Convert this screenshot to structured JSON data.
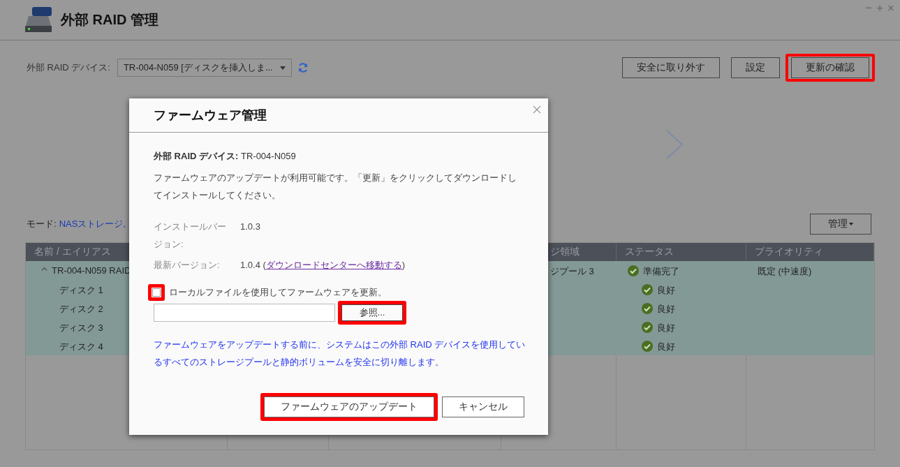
{
  "app": {
    "title": "外部 RAID 管理",
    "window_controls": [
      "−",
      "+",
      "×"
    ]
  },
  "toolbar": {
    "device_label": "外部 RAID デバイス:",
    "device_select": "TR-004-N059 [ディスクを挿入しま...",
    "buttons": [
      {
        "label": "安全に取り外す",
        "highlighted": false
      },
      {
        "label": "設定",
        "highlighted": false
      },
      {
        "label": "更新の確認",
        "highlighted": true
      }
    ]
  },
  "mode": {
    "label": "モード:",
    "value": "NASストレージ,"
  },
  "manage_button": {
    "label": "管理"
  },
  "table": {
    "columns": [
      "名前 / エイリアス",
      "",
      "",
      "ジ領域",
      "ステータス",
      "プライオリティ"
    ],
    "rows": [
      {
        "kind": "group",
        "name": "TR-004-N059 RAID",
        "expanded": true,
        "storage": "ジプール 3",
        "status": "準備完了",
        "priority": "既定 (中速度)",
        "selected": true
      },
      {
        "kind": "disk",
        "name": "ディスク 1",
        "status": "良好",
        "selected": true
      },
      {
        "kind": "disk",
        "name": "ディスク 2",
        "status": "良好",
        "selected": true
      },
      {
        "kind": "disk",
        "name": "ディスク 3",
        "status": "良好",
        "selected": true
      },
      {
        "kind": "disk",
        "name": "ディスク 4",
        "status": "良好",
        "selected": true
      }
    ]
  },
  "dialog": {
    "title": "ファームウェア管理",
    "device_label": "外部 RAID デバイス:",
    "device_value": "TR-004-N059",
    "message": "ファームウェアのアップデートが利用可能です。「更新」をクリックしてダウンロードしてインストールしてください。",
    "installed": {
      "label": "インストールバージョン:",
      "value": "1.0.3"
    },
    "latest": {
      "label": "最新バージョン:",
      "value_prefix": "1.0.4 (",
      "link": "ダウンロードセンターへ移動する",
      "value_suffix": ")"
    },
    "local_file": {
      "label": "ローカルファイルを使用してファームウェアを更新。",
      "checked": false,
      "highlighted": true
    },
    "browse_button": {
      "label": "参照...",
      "highlighted": true
    },
    "note": "ファームウェアをアップデートする前に、システムはこの外部 RAID デバイスを使用しているすべてのストレージプールと静的ボリュームを安全に切り離します。",
    "buttons": [
      {
        "label": "ファームウェアのアップデート",
        "highlighted": true
      },
      {
        "label": "キャンセル",
        "highlighted": false
      }
    ]
  }
}
